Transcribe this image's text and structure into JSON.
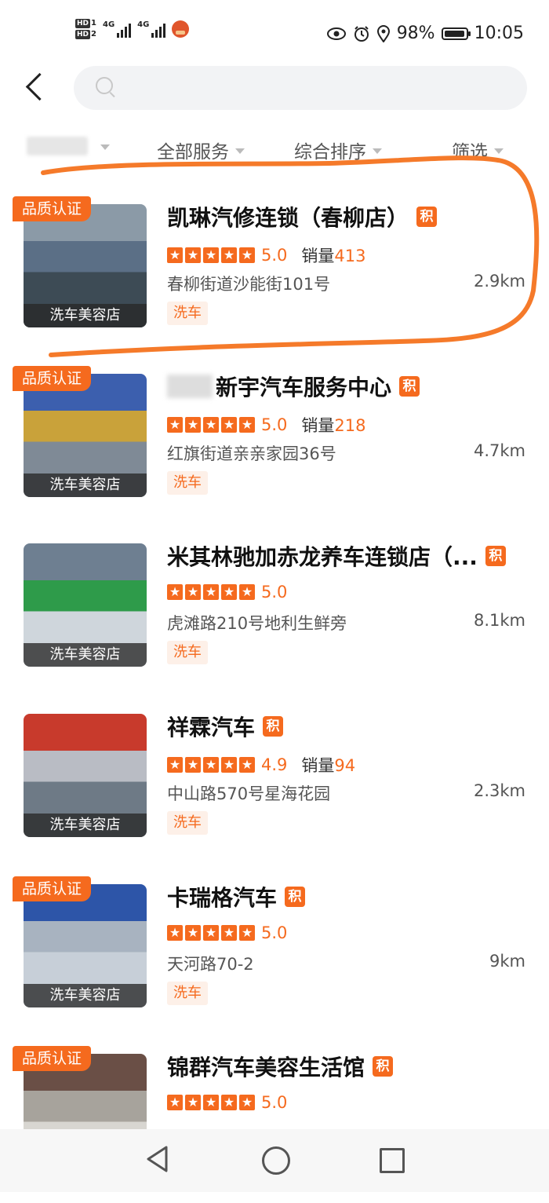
{
  "status_bar": {
    "hd1": "HD",
    "hd2": "HD",
    "net1": "4G",
    "net2": "4G",
    "battery_pct": "98%",
    "battery_level": 0.98,
    "time": "10:05",
    "icons": [
      "eye-icon",
      "alarm-icon",
      "location-icon"
    ]
  },
  "header": {
    "search_placeholder": ""
  },
  "filters": {
    "location": "",
    "service": "全部服务",
    "sort": "综合排序",
    "filter": "筛选"
  },
  "shops": [
    {
      "name": "凯琳汽修连锁（春柳店）",
      "badge": "品质认证",
      "ji": "积",
      "rating": "5.0",
      "sales_label": "销量",
      "sales": "413",
      "address": "春柳街道沙能街101号",
      "distance": "2.9km",
      "tag": "洗车",
      "thumb_label": "洗车美容店",
      "stars": 5
    },
    {
      "name": "新宇汽车服务中心",
      "badge": "品质认证",
      "ji": "积",
      "rating": "5.0",
      "sales_label": "销量",
      "sales": "218",
      "address": "红旗街道亲亲家园36号",
      "distance": "4.7km",
      "tag": "洗车",
      "thumb_label": "洗车美容店",
      "stars": 5
    },
    {
      "name": "米其林驰加赤龙养车连锁店（...",
      "badge": "",
      "ji": "积",
      "rating": "5.0",
      "sales_label": "",
      "sales": "",
      "address": "虎滩路210号地利生鲜旁",
      "distance": "8.1km",
      "tag": "洗车",
      "thumb_label": "洗车美容店",
      "stars": 5
    },
    {
      "name": "祥霖汽车",
      "badge": "",
      "ji": "积",
      "rating": "4.9",
      "sales_label": "销量",
      "sales": "94",
      "address": "中山路570号星海花园",
      "distance": "2.3km",
      "tag": "洗车",
      "thumb_label": "洗车美容店",
      "stars": 5
    },
    {
      "name": "卡瑞格汽车",
      "badge": "品质认证",
      "ji": "积",
      "rating": "5.0",
      "sales_label": "",
      "sales": "",
      "address": "天河路70-2",
      "distance": "9km",
      "tag": "洗车",
      "thumb_label": "洗车美容店",
      "stars": 5
    },
    {
      "name": "锦群汽车美容生活馆",
      "badge": "品质认证",
      "ji": "积",
      "rating": "5.0",
      "sales_label": "",
      "sales": "",
      "address": "",
      "distance": "",
      "tag": "",
      "thumb_label": "",
      "stars": 5
    }
  ],
  "colors": {
    "accent": "#f56a1e",
    "annotation": "#f57a2a"
  }
}
